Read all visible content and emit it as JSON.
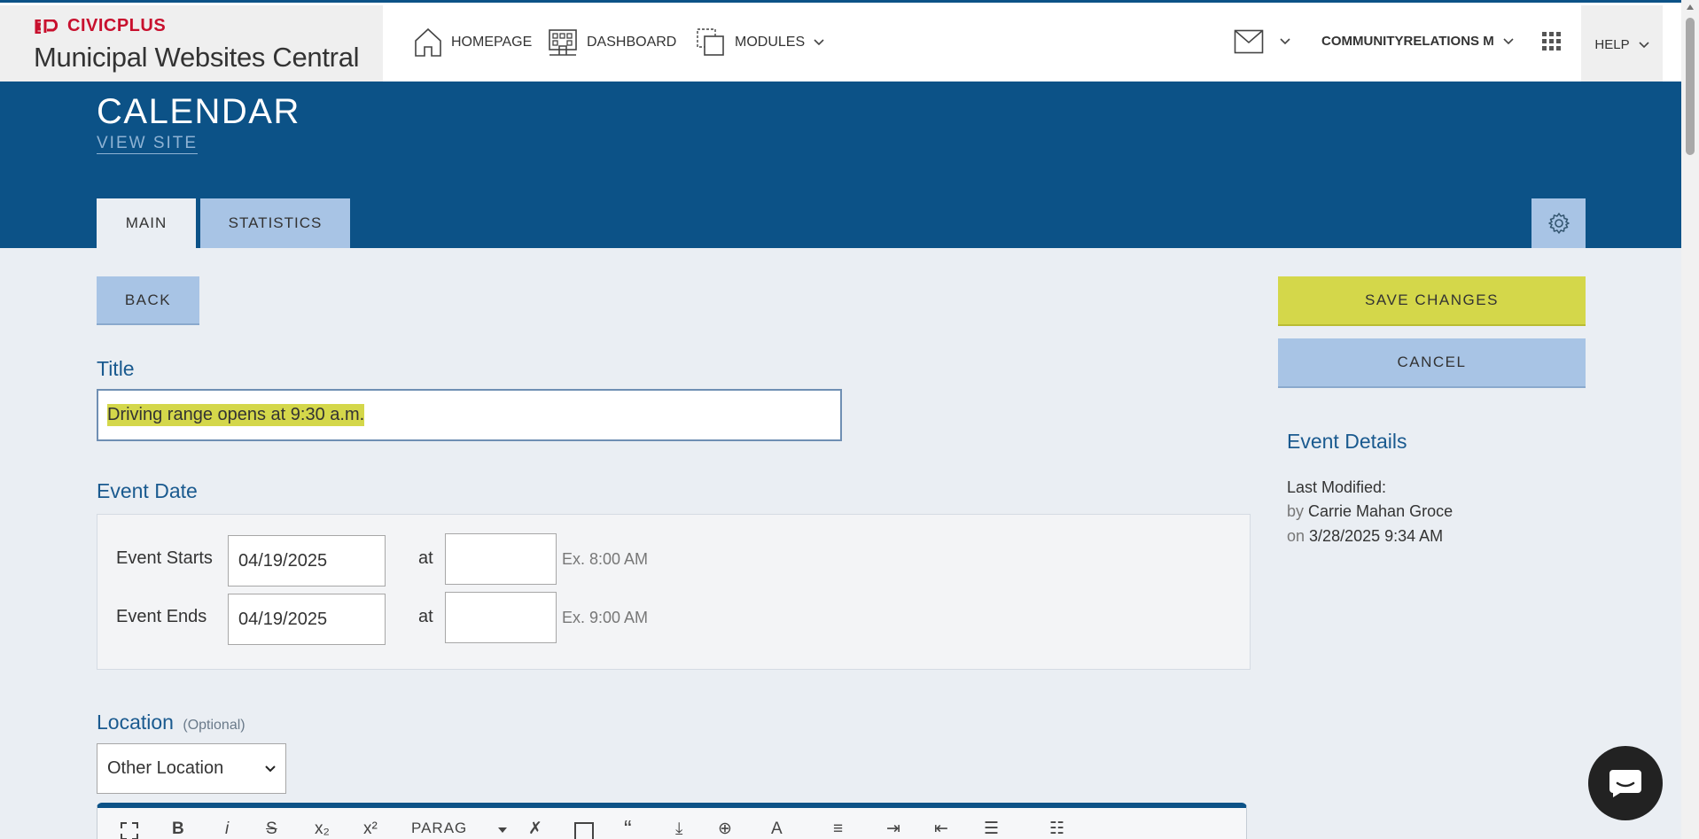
{
  "topbar": {
    "brand_logo": "CIVICPLUS",
    "brand_title": "Municipal Websites Central",
    "nav": {
      "homepage": "HOMEPAGE",
      "dashboard": "DASHBOARD",
      "modules": "MODULES"
    },
    "user": "COMMUNITYRELATIONS M",
    "help": "HELP",
    "icons": [
      "home-icon",
      "dashboard-icon",
      "modules-icon",
      "mail-icon",
      "apps-grid-icon",
      "chevron-down-icon"
    ]
  },
  "header": {
    "title": "CALENDAR",
    "view_site": "VIEW SITE",
    "tabs": [
      {
        "label": "MAIN",
        "active": true
      },
      {
        "label": "STATISTICS",
        "active": false
      }
    ]
  },
  "actions": {
    "back": "BACK",
    "save": "SAVE CHANGES",
    "cancel": "CANCEL"
  },
  "form": {
    "title_label": "Title",
    "title_value": "Driving range opens at 9:30 a.m.",
    "event_date_label": "Event Date",
    "starts_label": "Event Starts",
    "starts_date": "04/19/2025",
    "starts_time": "",
    "starts_hint": "Ex. 8:00 AM",
    "ends_label": "Event Ends",
    "ends_date": "04/19/2025",
    "ends_time": "",
    "ends_hint": "Ex. 9:00 AM",
    "at": "at",
    "location_label": "Location",
    "location_optional": "(Optional)",
    "location_value": "Other Location"
  },
  "editor": {
    "paragraph_label": "PARAG"
  },
  "details": {
    "heading": "Event Details",
    "last_modified": "Last Modified:",
    "by_prefix": "by",
    "by_value": "Carrie Mahan Groce",
    "on_prefix": "on",
    "on_value": "3/28/2025 9:34 AM"
  },
  "colors": {
    "brand_blue": "#0c5287",
    "light_blue": "#a8c4e5",
    "save_yellow": "#d4d74a",
    "civicplus_red": "#c8102e"
  }
}
